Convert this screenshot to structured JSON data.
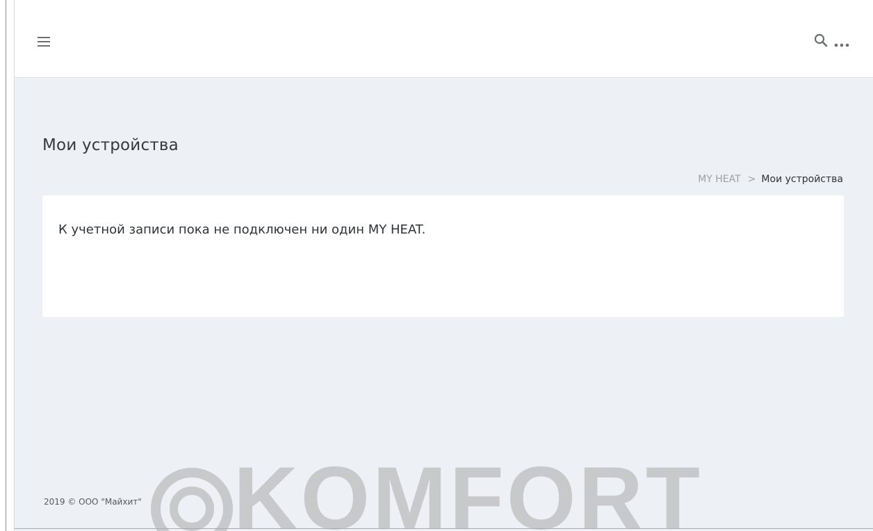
{
  "header": {
    "menu_icon": "hamburger-menu-icon",
    "search_icon": "search-icon",
    "more_icon": "more-horizontal-icon"
  },
  "page": {
    "title": "Мои устройства"
  },
  "breadcrumb": {
    "home": "MY HEAT",
    "separator": ">",
    "current": "Мои устройства"
  },
  "card": {
    "message": "К учетной записи пока не подключен ни один MY HEAT."
  },
  "watermark": {
    "text": "KOMFORT"
  },
  "footer": {
    "copyright": "2019 © ООО \"Майхит\""
  },
  "colors": {
    "background": "#edf0f4",
    "header": "#ffffff",
    "text": "#2f3338",
    "muted": "#9aa1a8",
    "watermark": "#c8c9cb"
  }
}
